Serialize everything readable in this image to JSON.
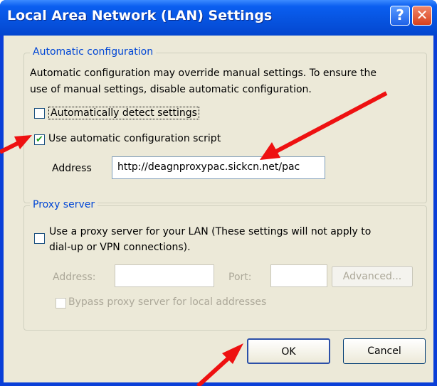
{
  "dialog": {
    "title": "Local Area Network (LAN) Settings",
    "help_glyph": "?",
    "close_glyph": "✕"
  },
  "auto_config": {
    "legend": "Automatic configuration",
    "desc_line1": "Automatic configuration may override manual settings.  To ensure the",
    "desc_line2": "use of manual settings, disable automatic configuration.",
    "auto_detect_label": "Automatically detect settings",
    "auto_detect_checked": false,
    "use_script_label": "Use automatic configuration script",
    "use_script_checked": true,
    "address_label": "Address",
    "address_value": "http://deagnproxypac.sickcn.net/pac"
  },
  "proxy": {
    "legend": "Proxy server",
    "use_proxy_line1": "Use a proxy server for your LAN (These settings will not apply to",
    "use_proxy_line2": "dial-up or VPN connections).",
    "use_proxy_checked": false,
    "address_label": "Address:",
    "port_label": "Port:",
    "advanced_label": "Advanced...",
    "bypass_label": "Bypass proxy server for local addresses",
    "bypass_checked": false
  },
  "buttons": {
    "ok_label": "OK",
    "cancel_label": "Cancel"
  },
  "colors": {
    "annotation_arrow": "#ee1111",
    "title_bar": "#0754e0",
    "legend_text": "#0046d5",
    "check_mark": "#21a121"
  }
}
